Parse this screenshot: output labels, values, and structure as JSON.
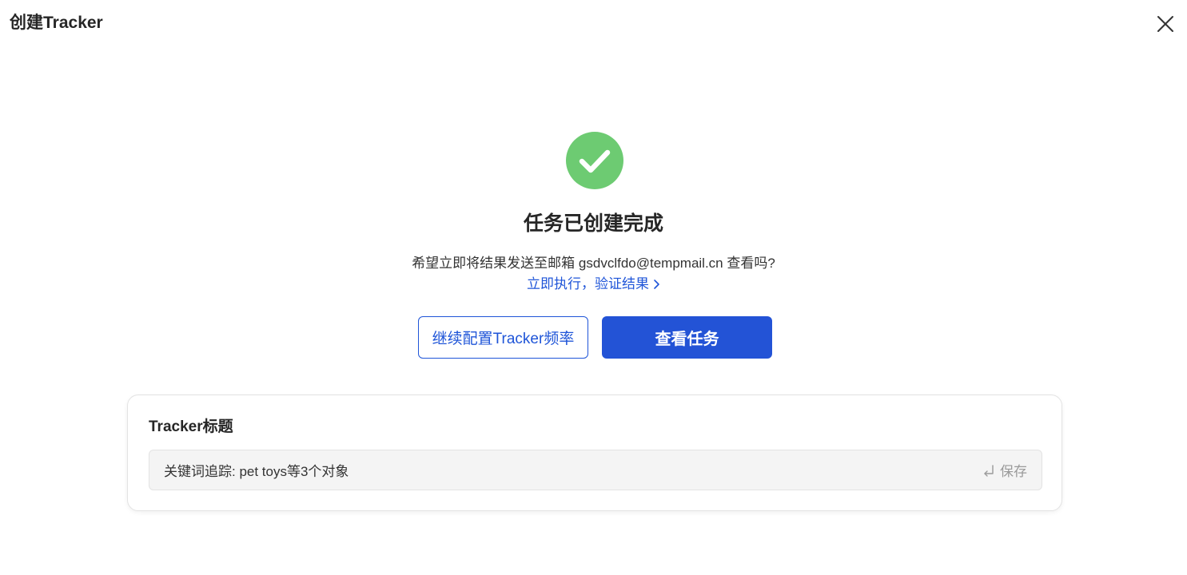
{
  "header": {
    "title": "创建Tracker"
  },
  "success": {
    "title": "任务已创建完成",
    "prompt": "希望立即将结果发送至邮箱 gsdvclfdo@tempmail.cn 查看吗?",
    "execute_link": "立即执行，验证结果"
  },
  "actions": {
    "configure_label": "继续配置Tracker频率",
    "view_label": "查看任务"
  },
  "tracker_title": {
    "label": "Tracker标题",
    "value": "关键词追踪: pet toys等3个对象",
    "save_label": "保存"
  },
  "colors": {
    "accent": "#2353d6",
    "success": "#6dcb72"
  },
  "icons": {
    "close": "close-icon",
    "success": "check-circle-icon",
    "link_arrow": "chevron-right-icon",
    "save": "enter-key-icon"
  }
}
